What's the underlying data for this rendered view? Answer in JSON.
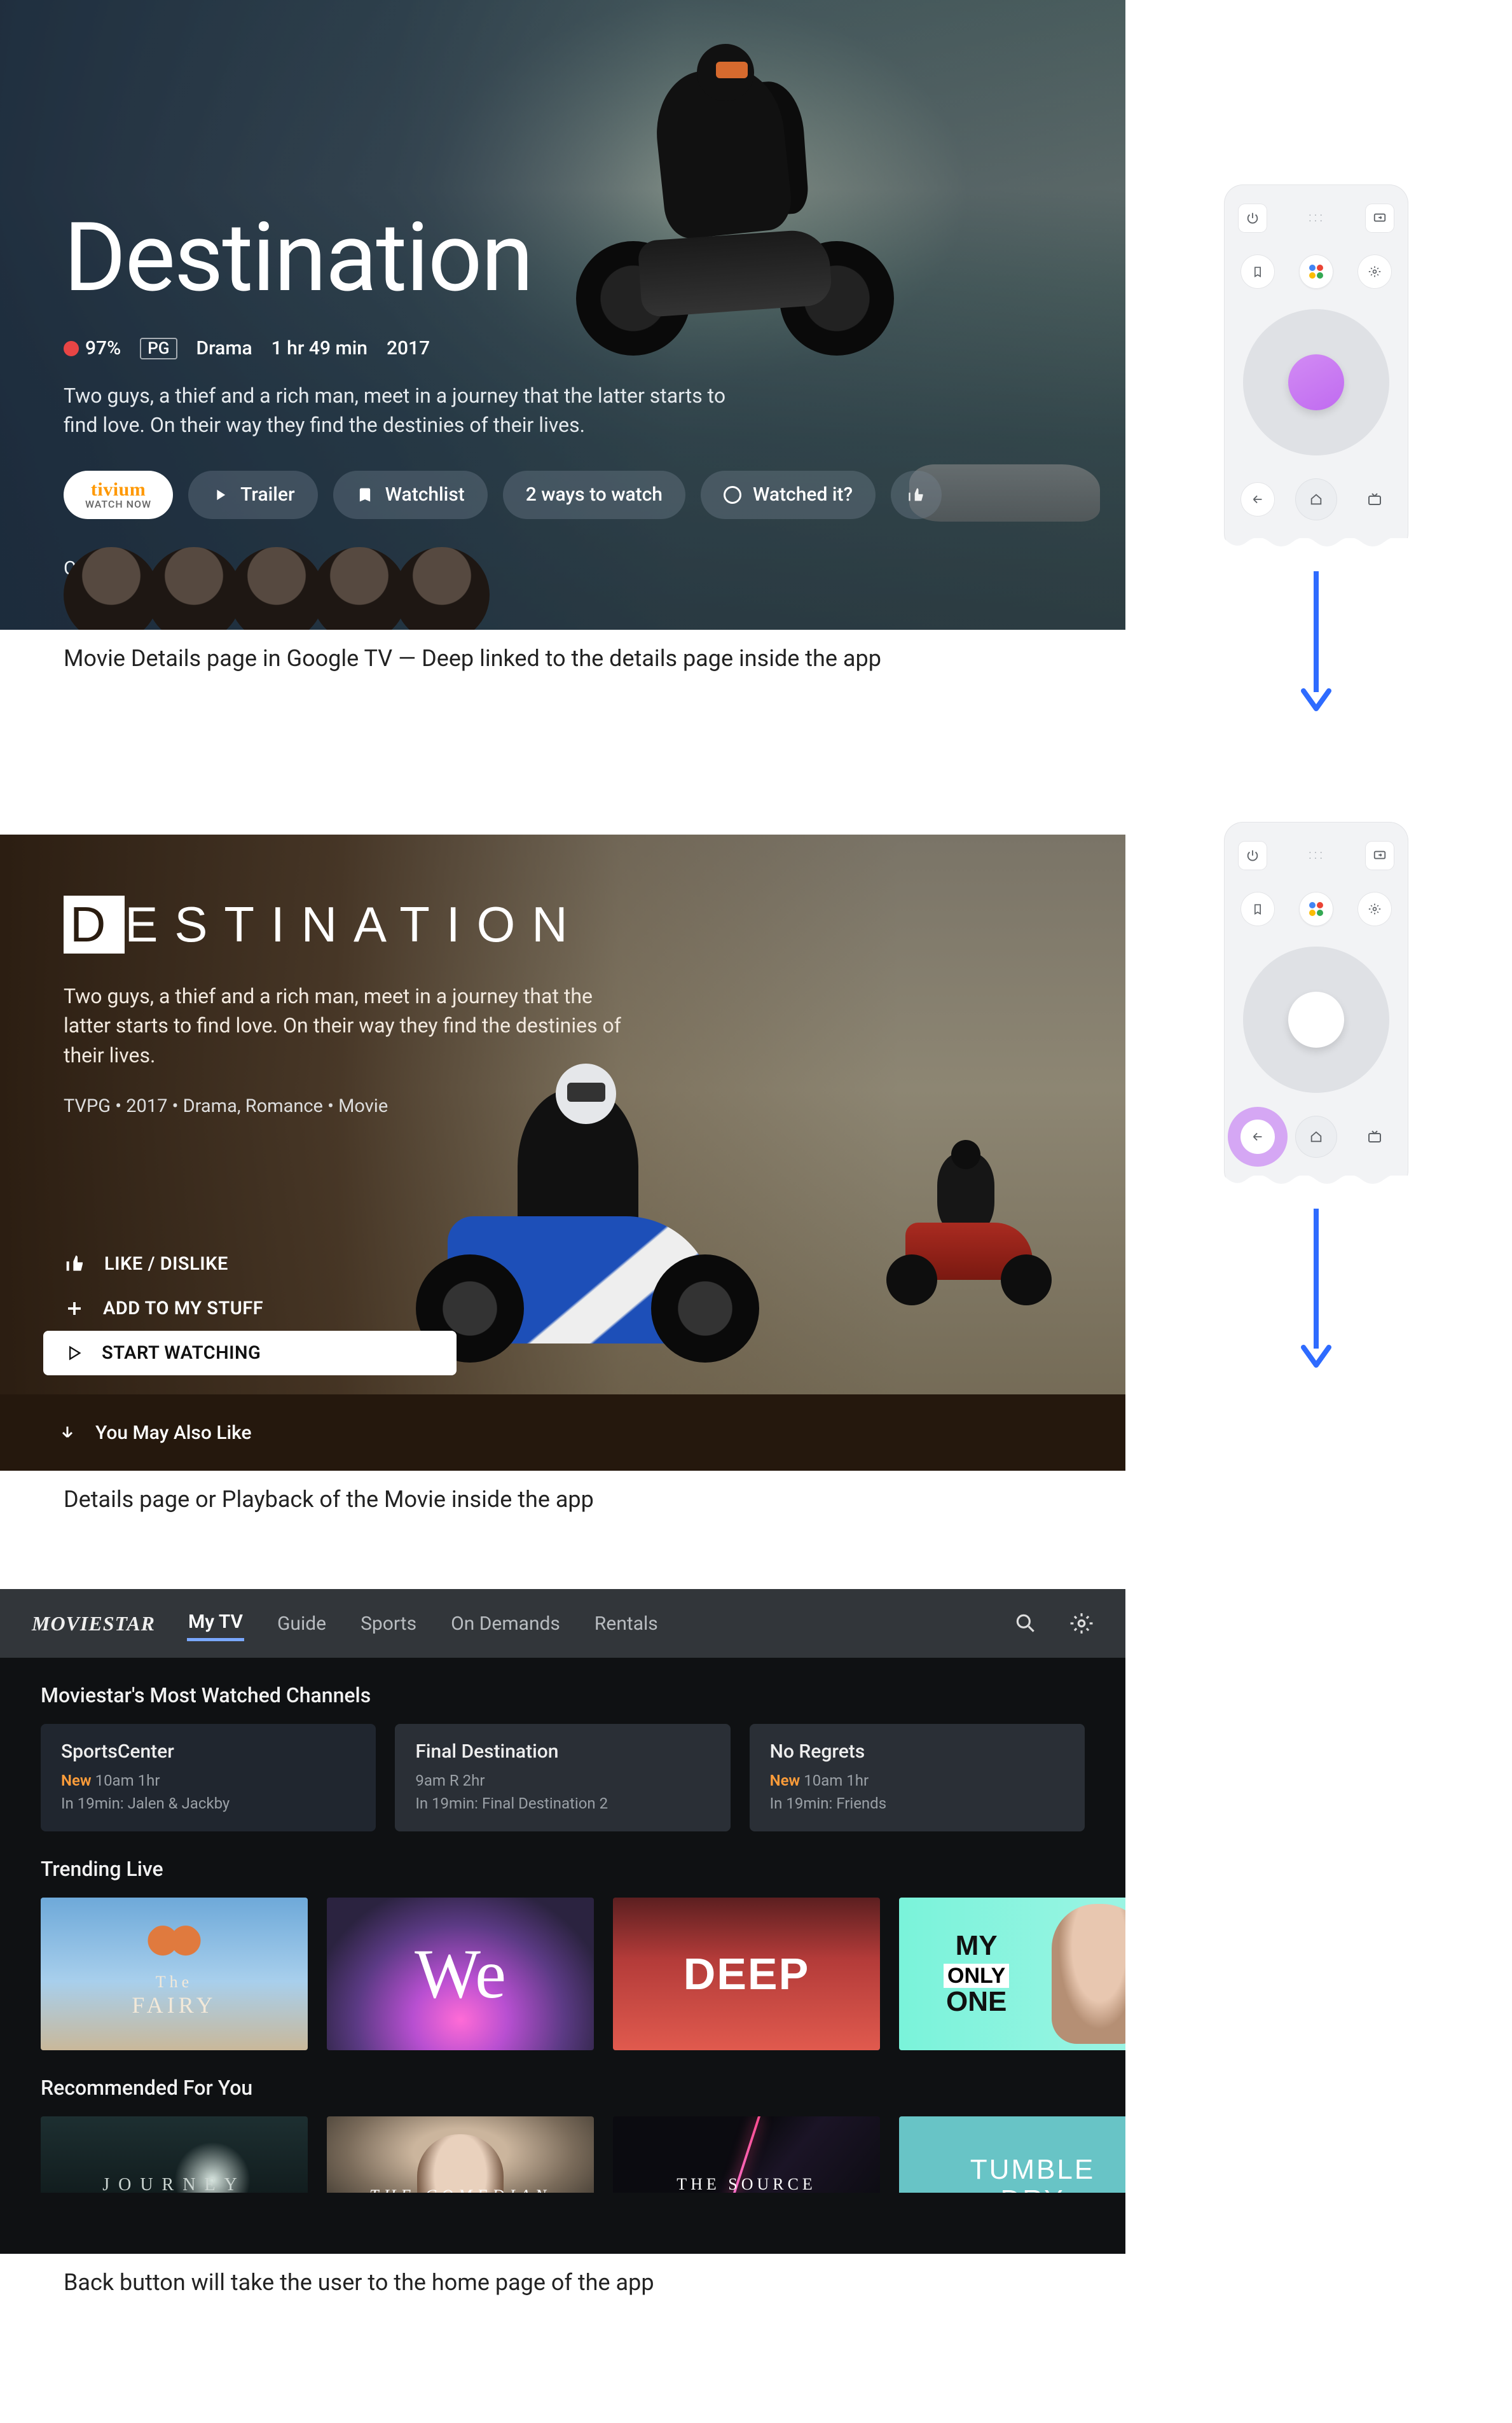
{
  "screen1": {
    "title": "Destination",
    "score": "97%",
    "rating": "PG",
    "genre": "Drama",
    "duration": "1 hr 49 min",
    "year": "2017",
    "description": "Two guys, a thief and a rich man, meet in a journey that the latter starts to find love. On their way they find the destinies of their lives.",
    "provider_brand": "tivium",
    "provider_sub": "WATCH NOW",
    "btn_trailer": "Trailer",
    "btn_watchlist": "Watchlist",
    "btn_ways": "2 ways to watch",
    "btn_watched": "Watched it?",
    "cast_label": "Cast"
  },
  "caption1": "Movie Details page in Google TV — Deep linked to the details page inside the app",
  "screen2": {
    "title_first": "D",
    "title_rest": "ESTINATION",
    "description": "Two guys, a thief and a rich man, meet in a journey that the latter starts to find love. On their way they find the destinies of their lives.",
    "meta": "TVPG • 2017 • Drama, Romance • Movie",
    "like": "LIKE / DISLIKE",
    "add": "ADD TO MY STUFF",
    "start": "START WATCHING",
    "youmay": "You May Also Like"
  },
  "caption2": "Details page or Playback of the Movie inside the app",
  "screen3": {
    "brand": "MOVIESTAR",
    "tabs": [
      "My TV",
      "Guide",
      "Sports",
      "On Demands",
      "Rentals"
    ],
    "active_tab": 0,
    "row1_title": "Moviestar's Most Watched Channels",
    "channels": [
      {
        "title": "SportsCenter",
        "new": "New",
        "time": "10am 1hr",
        "next": "In 19min: Jalen & Jackby"
      },
      {
        "title": "Final Destination",
        "new": "",
        "time": "9am R 2hr",
        "next": "In 19min: Final Destination 2"
      },
      {
        "title": "No Regrets",
        "new": "New",
        "time": "10am 1hr",
        "next": "In 19min: Friends"
      }
    ],
    "row2_title": "Trending Live",
    "trending": [
      {
        "label_small": "The",
        "label_big": "FAIRY"
      },
      {
        "cursive": "We"
      },
      {
        "big": "DEEP"
      },
      {
        "l1": "MY",
        "only": "ONLY",
        "l3": "ONE"
      }
    ],
    "row3_title": "Recommended For You",
    "recommended": [
      "JOURNEY",
      "THE COMEDIAN",
      "THE SOURCE",
      "TUMBLE\nDRY"
    ]
  },
  "caption3": "Back button will take the user to the home page of the app",
  "remote": {
    "power": "power-icon",
    "input": "input-icon",
    "bookmark": "bookmark-icon",
    "settings": "gear-icon",
    "back": "back-icon",
    "home": "home-icon",
    "live": "live-tv-icon",
    "assistant": "assistant-icon"
  },
  "colors": {
    "accent_purple": "#c06bf0",
    "arrow": "#2e6bff"
  }
}
